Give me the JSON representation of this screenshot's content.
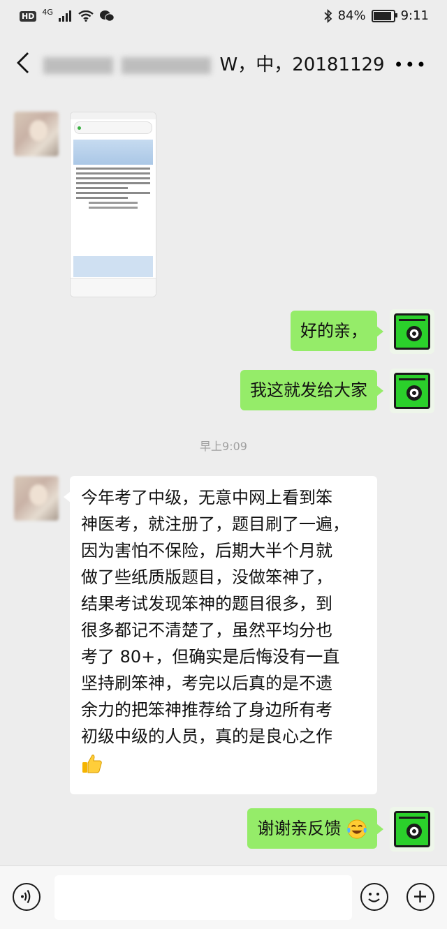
{
  "status_bar": {
    "hd_badge": "HD",
    "network": "4G",
    "battery": "84%",
    "battery_level": 0.84,
    "time": "9:11"
  },
  "header": {
    "title_visible": "W，中，20181129"
  },
  "messages": [
    {
      "id": "m1",
      "direction": "in",
      "type": "image"
    },
    {
      "id": "m2",
      "direction": "out",
      "type": "text",
      "text": "好的亲，"
    },
    {
      "id": "m3",
      "direction": "out",
      "type": "text",
      "text": "我这就发给大家"
    },
    {
      "id": "sep",
      "type": "time",
      "text": "早上9:09"
    },
    {
      "id": "m4",
      "direction": "in",
      "type": "text",
      "lines": [
        "今年考了中级，无意中网上看到笨",
        "神医考，就注册了，题目刷了一遍，",
        "因为害怕不保险，后期大半个月就",
        "做了些纸质版题目，没做笨神了，",
        "结果考试发现笨神的题目很多，到",
        "很多都记不清楚了，虽然平均分也",
        "考了 80+，但确实是后悔没有一直",
        "坚持刷笨神，考完以后真的是不遗",
        "余力的把笨神推荐给了身边所有考",
        "初级中级的人员，真的是良心之作"
      ],
      "trailing_emoji": "thumbs-up"
    },
    {
      "id": "m5",
      "direction": "out",
      "type": "text",
      "text": "谢谢亲反馈",
      "trailing_emoji": "tears-of-joy"
    }
  ],
  "input_bar": {
    "placeholder": ""
  }
}
